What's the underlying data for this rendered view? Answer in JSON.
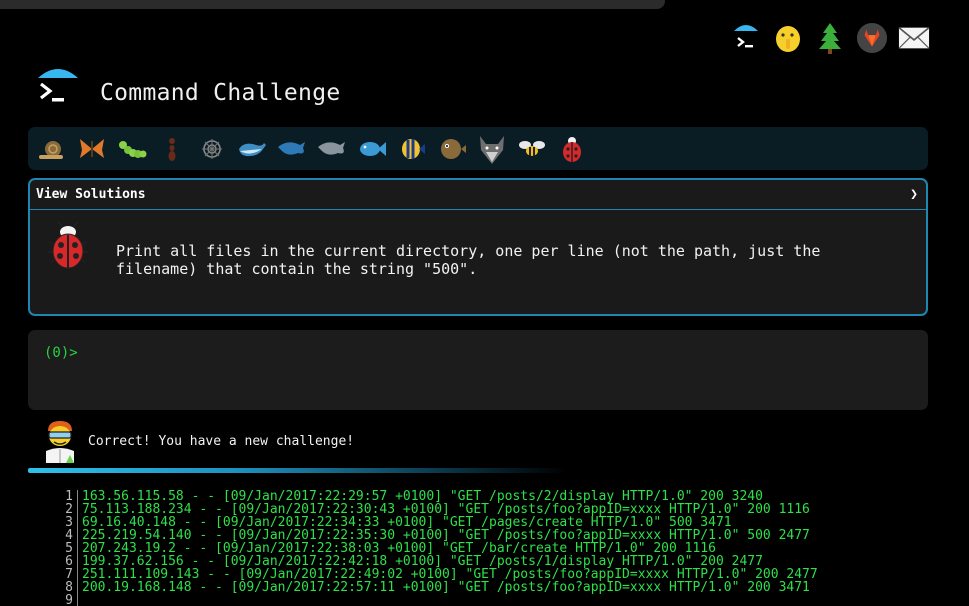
{
  "app": {
    "title": "Command Challenge"
  },
  "top_icons": [
    {
      "name": "terminal-icon"
    },
    {
      "name": "shush-emoji-icon"
    },
    {
      "name": "tree-icon"
    },
    {
      "name": "gitlab-icon"
    },
    {
      "name": "mail-icon"
    }
  ],
  "animals": [
    "snail-icon",
    "butterfly-icon",
    "caterpillar-icon",
    "ant-icon",
    "shell-icon",
    "whale-icon",
    "dolphin-icon",
    "dolphin-gray-icon",
    "fish-icon",
    "tropical-fish-icon",
    "pufferfish-icon",
    "wolf-icon",
    "bee-icon",
    "ladybug-icon"
  ],
  "panel": {
    "header_label": "View Solutions",
    "chevron": "❯",
    "question": "Print all files in the current directory, one per line (not the path, just the filename) that contain the string \"500\"."
  },
  "terminal": {
    "prompt": "(0)>"
  },
  "result": {
    "message": "Correct! You have a new challenge!"
  },
  "output_lines": [
    {
      "n": "1",
      "text": "163.56.115.58 - - [09/Jan/2017:22:29:57 +0100] \"GET /posts/2/display HTTP/1.0\" 200 3240"
    },
    {
      "n": "2",
      "text": "75.113.188.234 - - [09/Jan/2017:22:30:43 +0100] \"GET /posts/foo?appID=xxxx HTTP/1.0\" 200 1116"
    },
    {
      "n": "3",
      "text": "69.16.40.148 - - [09/Jan/2017:22:34:33 +0100] \"GET /pages/create HTTP/1.0\" 500 3471"
    },
    {
      "n": "4",
      "text": "225.219.54.140 - - [09/Jan/2017:22:35:30 +0100] \"GET /posts/foo?appID=xxxx HTTP/1.0\" 500 2477"
    },
    {
      "n": "5",
      "text": "207.243.19.2 - - [09/Jan/2017:22:38:03 +0100] \"GET /bar/create HTTP/1.0\" 200 1116"
    },
    {
      "n": "6",
      "text": "199.37.62.156 - - [09/Jan/2017:22:42:18 +0100] \"GET /posts/1/display HTTP/1.0\" 200 2477"
    },
    {
      "n": "7",
      "text": "251.111.109.143 - - [09/Jan/2017:22:49:02 +0100] \"GET /posts/foo?appID=xxxx HTTP/1.0\" 200 2477"
    },
    {
      "n": "8",
      "text": "200.19.168.148 - - [09/Jan/2017:22:57:11 +0100] \"GET /posts/foo?appID=xxxx HTTP/1.0\" 200 3471"
    },
    {
      "n": "9",
      "text": ""
    }
  ],
  "colors": {
    "accent": "#1e86b0",
    "prompt_green": "#27d342",
    "output_green": "#2ee04a"
  }
}
